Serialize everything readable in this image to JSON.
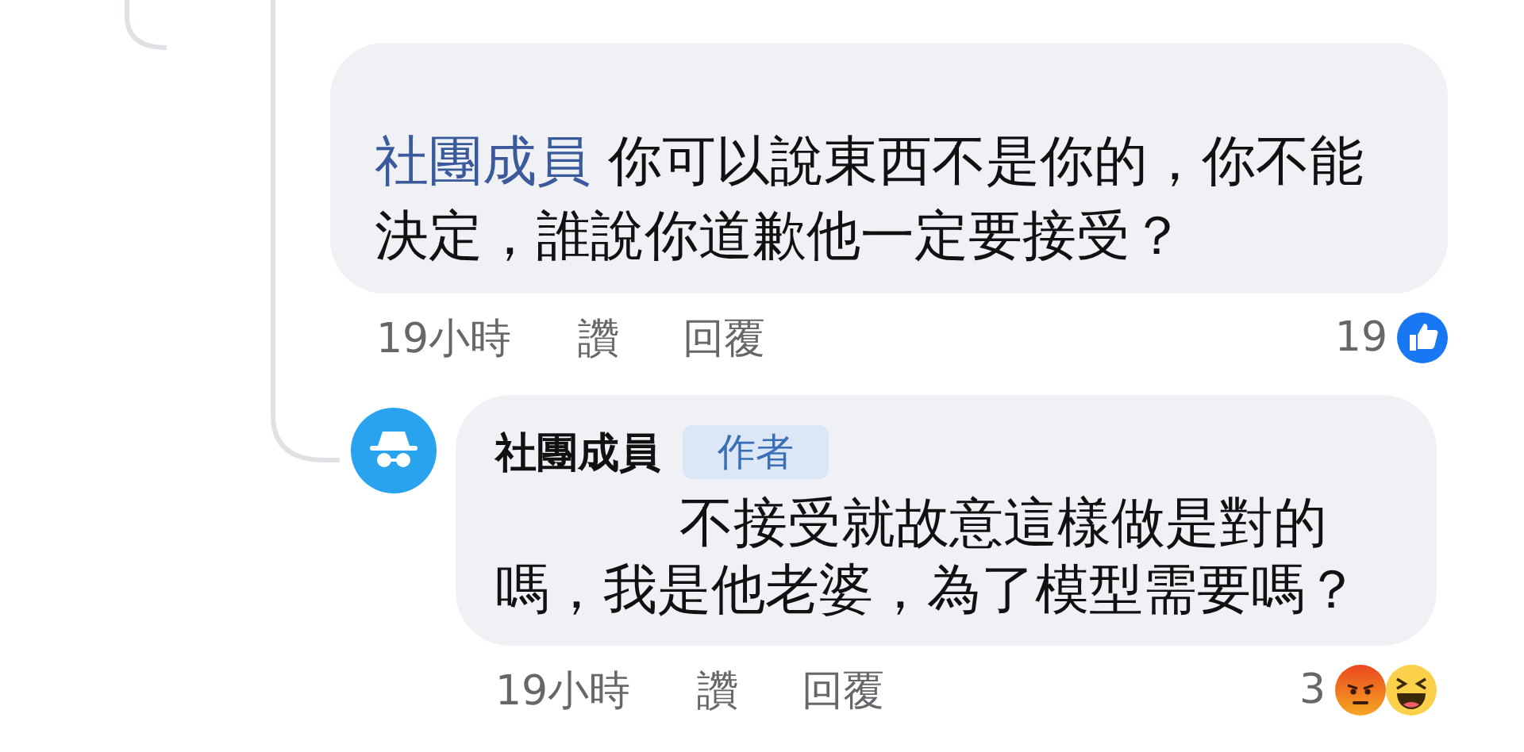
{
  "comments": [
    {
      "kind": "inline",
      "author": "社團成員",
      "text": "你可以說東西不是你的，你不能決定，誰說你道歉他一定要接受？",
      "time": "19小時",
      "like": "讚",
      "reply": "回覆",
      "reaction_count": "19",
      "reactions": [
        {
          "kind": "like"
        }
      ]
    },
    {
      "kind": "block",
      "avatar": true,
      "author": "社團成員",
      "badge": "作者",
      "text": "不接受就故意這樣做是對的嗎，我是他老婆，為了模型需要嗎？",
      "time": "19小時",
      "like": "讚",
      "reply": "回覆",
      "reaction_count": "3",
      "reactions": [
        {
          "kind": "angry"
        },
        {
          "kind": "haha"
        }
      ]
    }
  ]
}
